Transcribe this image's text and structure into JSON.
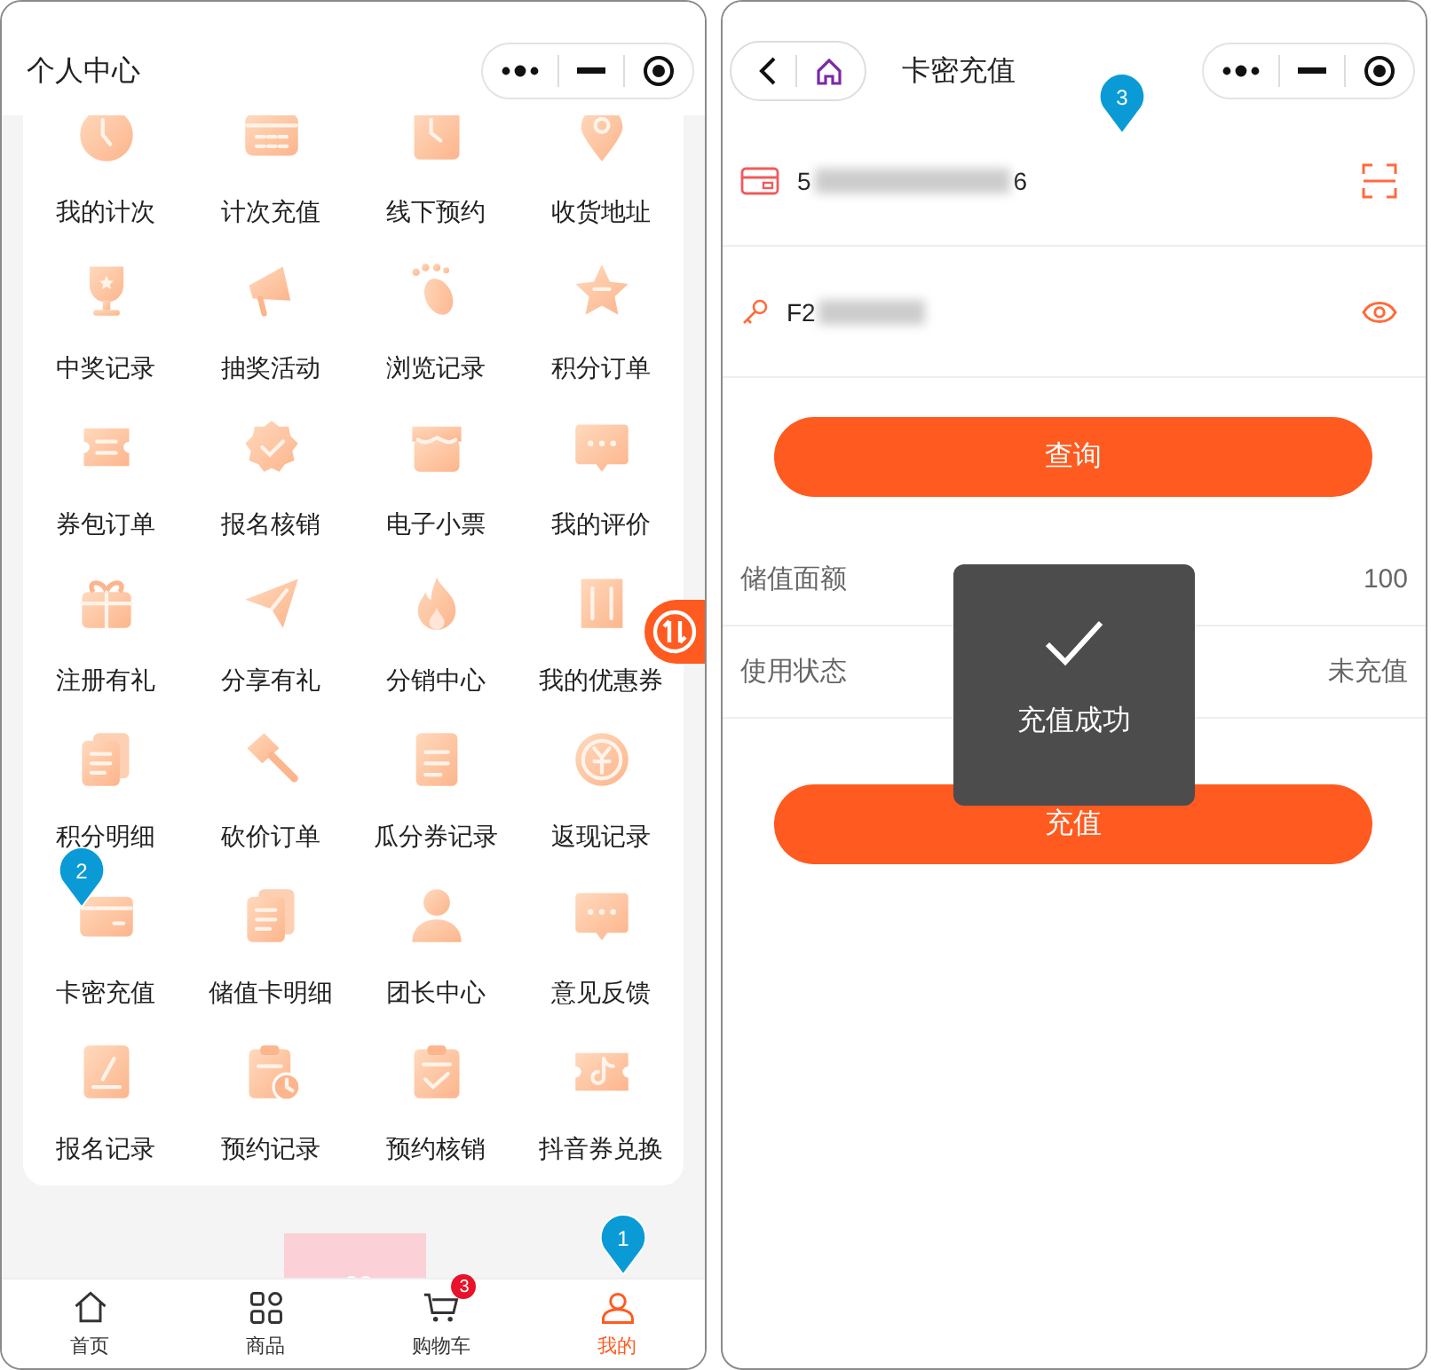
{
  "left_screen": {
    "title": "个人中心",
    "menu_grid": [
      {
        "label": "我的计次"
      },
      {
        "label": "计次充值"
      },
      {
        "label": "线下预约"
      },
      {
        "label": "收货地址"
      },
      {
        "label": "中奖记录"
      },
      {
        "label": "抽奖活动"
      },
      {
        "label": "浏览记录"
      },
      {
        "label": "积分订单"
      },
      {
        "label": "券包订单"
      },
      {
        "label": "报名核销"
      },
      {
        "label": "电子小票"
      },
      {
        "label": "我的评价"
      },
      {
        "label": "注册有礼"
      },
      {
        "label": "分享有礼"
      },
      {
        "label": "分销中心"
      },
      {
        "label": "我的优惠券"
      },
      {
        "label": "积分明细"
      },
      {
        "label": "砍价订单"
      },
      {
        "label": "瓜分券记录"
      },
      {
        "label": "返现记录"
      },
      {
        "label": "卡密充值"
      },
      {
        "label": "储值卡明细"
      },
      {
        "label": "团长中心"
      },
      {
        "label": "意见反馈"
      },
      {
        "label": "报名记录"
      },
      {
        "label": "预约记录"
      },
      {
        "label": "预约核销"
      },
      {
        "label": "抖音券兑换"
      }
    ],
    "tab_bar": [
      {
        "label": "首页",
        "selected": false
      },
      {
        "label": "商品",
        "selected": false
      },
      {
        "label": "购物车",
        "selected": false,
        "badge": "3"
      },
      {
        "label": "我的",
        "selected": true
      }
    ]
  },
  "right_screen": {
    "title": "卡密充值",
    "card_number_field": {
      "value": "5",
      "value_end": "6"
    },
    "password_field": {
      "value": "F2"
    },
    "query_button": "查询",
    "info_rows": [
      {
        "label": "储值面额",
        "value": "100"
      },
      {
        "label": "使用状态",
        "value": "未充值"
      }
    ],
    "recharge_button": "充值",
    "toast": {
      "message": "充值成功"
    }
  },
  "annotation_pins": [
    {
      "label": "1"
    },
    {
      "label": "2"
    },
    {
      "label": "3"
    }
  ]
}
